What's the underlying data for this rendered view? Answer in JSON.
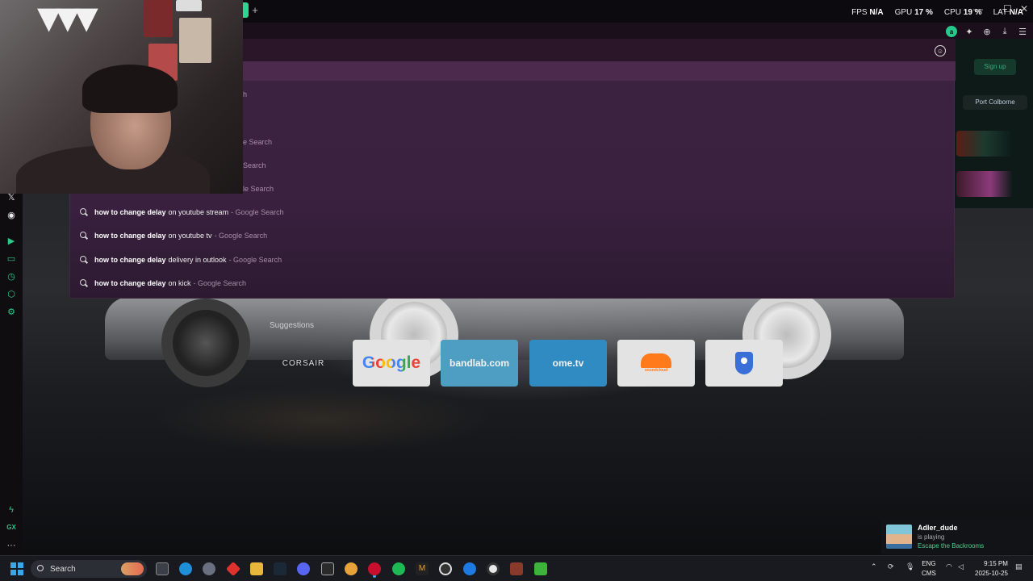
{
  "browser": {
    "new_tab_symbol": "+",
    "window_controls": [
      "—",
      "☐",
      "✕"
    ]
  },
  "hud": [
    {
      "label": "FPS",
      "value": "N/A"
    },
    {
      "label": "GPU",
      "value": "17 %"
    },
    {
      "label": "CPU",
      "value": "19 %"
    },
    {
      "label": "LAT",
      "value": "N/A"
    }
  ],
  "omnibox": {
    "emoji_icon": "emoji-icon"
  },
  "dropdown": {
    "partials": [
      "h",
      "e Search",
      "Search",
      "le Search"
    ],
    "suggestions": [
      {
        "bold": "how to change delay",
        "rest": "on youtube stream",
        "source": "- Google Search"
      },
      {
        "bold": "how to change delay",
        "rest": "on youtube tv",
        "source": "- Google Search"
      },
      {
        "bold": "how to change delay",
        "rest": "delivery in outlook",
        "source": "- Google Search"
      },
      {
        "bold": "how to change delay",
        "rest": "on kick",
        "source": "- Google Search"
      }
    ]
  },
  "right_panel": {
    "signup": "Sign up",
    "city": "Port Colborne"
  },
  "speed_dial": {
    "label": "Suggestions",
    "tiles": [
      {
        "name": "corsair",
        "label": "CORSAIR"
      },
      {
        "name": "google",
        "label": "Google"
      },
      {
        "name": "bandlab",
        "label": "bandlab.com"
      },
      {
        "name": "ometv",
        "label": "ome.tv"
      },
      {
        "name": "soundcloud",
        "label": "soundcloud"
      },
      {
        "name": "shield",
        "label": ""
      }
    ]
  },
  "sidebar": {
    "icons": [
      "x-icon",
      "discord-icon",
      "play-icon",
      "wallet-icon",
      "history-icon",
      "extensions-icon",
      "settings-icon",
      "twitch-icon",
      "gx-icon",
      "more-icon"
    ],
    "gx_label": "GX",
    "more_label": "···"
  },
  "notification": {
    "user": "Adler_dude",
    "status": "is playing",
    "game": "Escape the Backrooms"
  },
  "taskbar": {
    "search_placeholder": "Search",
    "lang_top": "ENG",
    "lang_bottom": "CMS",
    "time": "9:15 PM",
    "date": "2025-10-25"
  },
  "colors": {
    "accent_green": "#2fd58e",
    "dropdown_bg": "#3a2140",
    "highlight": "#4b2a4d",
    "taskbar_bg": "#181a1f"
  }
}
